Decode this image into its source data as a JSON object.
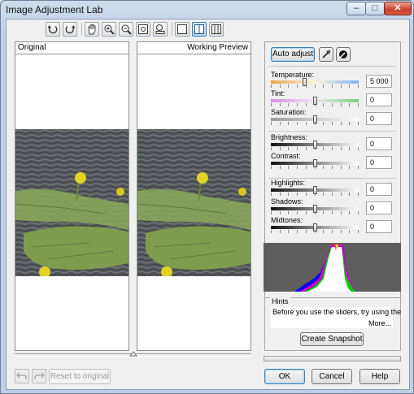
{
  "window": {
    "title": "Image Adjustment Lab",
    "controls": [
      "minimize",
      "maximize",
      "close"
    ]
  },
  "toolbar": {
    "icons": [
      "rotate-left-icon",
      "rotate-right-icon",
      "pan-hand-icon",
      "zoom-in-icon",
      "zoom-out-icon",
      "fit-to-window-icon",
      "actual-size-icon",
      "single-view-icon",
      "split-view-icon",
      "side-by-side-view-icon"
    ],
    "active_view": "split-view"
  },
  "panes": {
    "original_label": "Original",
    "preview_label": "Working Preview"
  },
  "controls": {
    "auto_adjust": "Auto adjust",
    "sliders": [
      {
        "key": "temperature",
        "label": "Temperature:",
        "value": "5 000",
        "position": 0.38
      },
      {
        "key": "tint",
        "label": "Tint:",
        "value": "0",
        "position": 0.5
      },
      {
        "key": "saturation",
        "label": "Saturation:",
        "value": "0",
        "position": 0.5
      },
      {
        "key": "brightness",
        "label": "Brightness:",
        "value": "0",
        "position": 0.5
      },
      {
        "key": "contrast",
        "label": "Contrast:",
        "value": "0",
        "position": 0.5
      },
      {
        "key": "highlights",
        "label": "Highlights:",
        "value": "0",
        "position": 0.5
      },
      {
        "key": "shadows",
        "label": "Shadows:",
        "value": "0",
        "position": 0.5
      },
      {
        "key": "midtones",
        "label": "Midtones:",
        "value": "0",
        "position": 0.5
      }
    ]
  },
  "hints": {
    "title": "Hints",
    "text": "Before you use the sliders, try using the",
    "more": "More..."
  },
  "buttons": {
    "create_snapshot": "Create Snapshot",
    "reset": "Reset to original",
    "ok": "OK",
    "cancel": "Cancel",
    "help": "Help"
  },
  "colors": {
    "accent": "#3c7fb1",
    "photo_water": "#55585c",
    "lily_pad": "#8aa55a",
    "flower": "#e0d424"
  }
}
